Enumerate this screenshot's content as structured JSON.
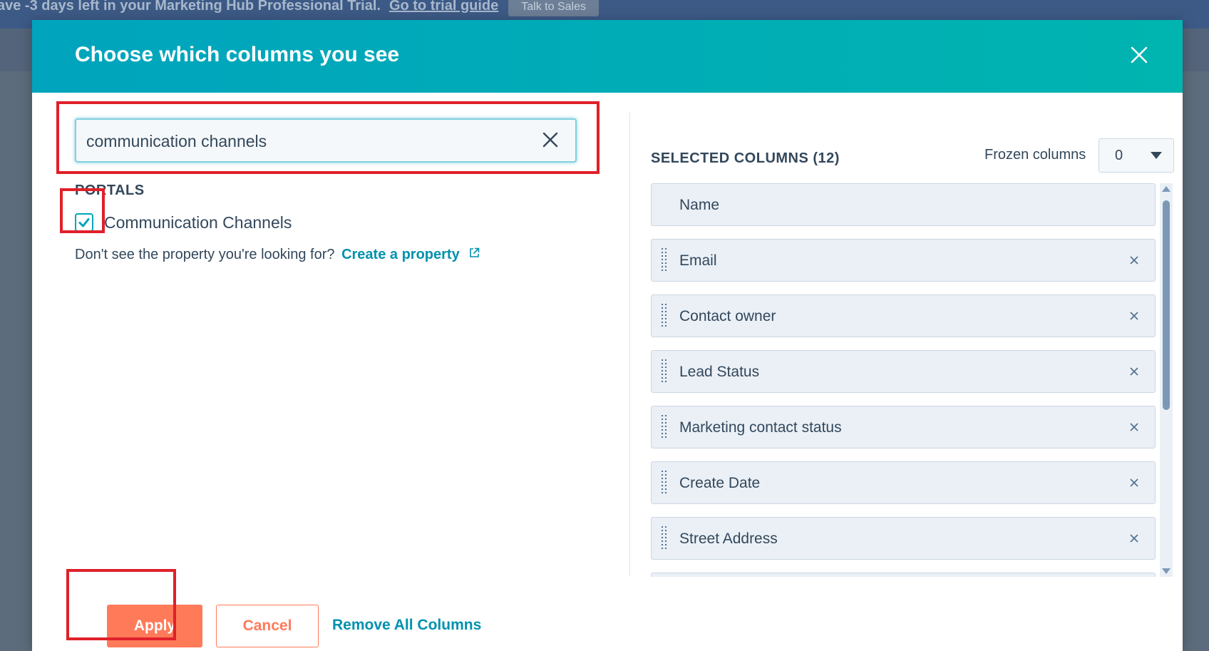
{
  "background": {
    "banner_text": "ave -3 days left in your Marketing Hub Professional Trial.",
    "banner_link": "Go to trial guide",
    "banner_button": "Talk to Sales"
  },
  "modal": {
    "title": "Choose which columns you see",
    "close_icon": "close-icon",
    "search": {
      "value": "communication channels",
      "clear_icon": "close-icon"
    },
    "section_label": "PORTALS",
    "option": {
      "label": "Communication Channels",
      "checked": true
    },
    "hint": {
      "text": "Don't see the property you're looking for?",
      "link": "Create a property",
      "link_icon": "external-link-icon"
    },
    "selected": {
      "title": "SELECTED COLUMNS (12)",
      "frozen_label": "Frozen columns",
      "frozen_value": "0",
      "columns": [
        {
          "label": "Name"
        },
        {
          "label": "Email"
        },
        {
          "label": "Contact owner"
        },
        {
          "label": "Lead Status"
        },
        {
          "label": "Marketing contact status"
        },
        {
          "label": "Create Date"
        },
        {
          "label": "Street Address"
        }
      ]
    },
    "footer": {
      "apply": "Apply",
      "cancel": "Cancel",
      "remove_all": "Remove All Columns"
    }
  },
  "colors": {
    "header_start": "#00a4bd",
    "header_end": "#00b4b0",
    "accent_orange": "#ff7a59",
    "link_teal": "#0091ae",
    "highlight_red": "#e0202a",
    "text_dark": "#33475b"
  }
}
